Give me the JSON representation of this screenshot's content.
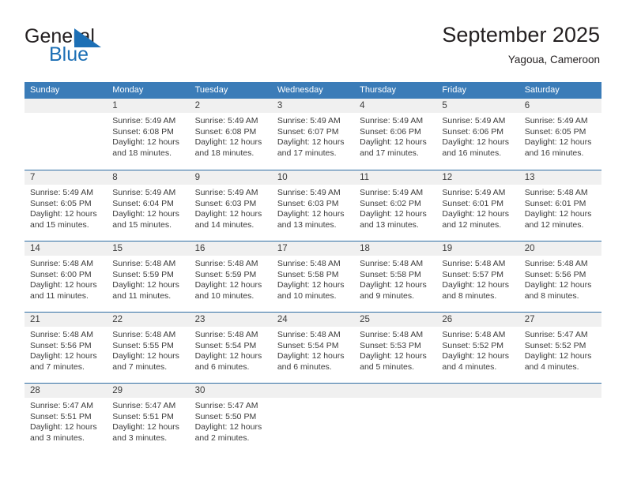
{
  "brand": {
    "name_top": "General",
    "name_bottom": "Blue",
    "flag_color": "#1c6fb5",
    "icon": "triangle-flag-icon"
  },
  "header": {
    "title": "September 2025",
    "subtitle": "Yagoua, Cameroon"
  },
  "theme": {
    "header_row_bg": "#3b7cb8",
    "row_divider": "#2e6da4",
    "day_number_bg": "#f0f0f0",
    "text": "#3b3b3b"
  },
  "weekdays": [
    "Sunday",
    "Monday",
    "Tuesday",
    "Wednesday",
    "Thursday",
    "Friday",
    "Saturday"
  ],
  "weeks": [
    [
      {
        "day": "",
        "lines": []
      },
      {
        "day": "1",
        "lines": [
          "Sunrise: 5:49 AM",
          "Sunset: 6:08 PM",
          "Daylight: 12 hours",
          "and 18 minutes."
        ]
      },
      {
        "day": "2",
        "lines": [
          "Sunrise: 5:49 AM",
          "Sunset: 6:08 PM",
          "Daylight: 12 hours",
          "and 18 minutes."
        ]
      },
      {
        "day": "3",
        "lines": [
          "Sunrise: 5:49 AM",
          "Sunset: 6:07 PM",
          "Daylight: 12 hours",
          "and 17 minutes."
        ]
      },
      {
        "day": "4",
        "lines": [
          "Sunrise: 5:49 AM",
          "Sunset: 6:06 PM",
          "Daylight: 12 hours",
          "and 17 minutes."
        ]
      },
      {
        "day": "5",
        "lines": [
          "Sunrise: 5:49 AM",
          "Sunset: 6:06 PM",
          "Daylight: 12 hours",
          "and 16 minutes."
        ]
      },
      {
        "day": "6",
        "lines": [
          "Sunrise: 5:49 AM",
          "Sunset: 6:05 PM",
          "Daylight: 12 hours",
          "and 16 minutes."
        ]
      }
    ],
    [
      {
        "day": "7",
        "lines": [
          "Sunrise: 5:49 AM",
          "Sunset: 6:05 PM",
          "Daylight: 12 hours",
          "and 15 minutes."
        ]
      },
      {
        "day": "8",
        "lines": [
          "Sunrise: 5:49 AM",
          "Sunset: 6:04 PM",
          "Daylight: 12 hours",
          "and 15 minutes."
        ]
      },
      {
        "day": "9",
        "lines": [
          "Sunrise: 5:49 AM",
          "Sunset: 6:03 PM",
          "Daylight: 12 hours",
          "and 14 minutes."
        ]
      },
      {
        "day": "10",
        "lines": [
          "Sunrise: 5:49 AM",
          "Sunset: 6:03 PM",
          "Daylight: 12 hours",
          "and 13 minutes."
        ]
      },
      {
        "day": "11",
        "lines": [
          "Sunrise: 5:49 AM",
          "Sunset: 6:02 PM",
          "Daylight: 12 hours",
          "and 13 minutes."
        ]
      },
      {
        "day": "12",
        "lines": [
          "Sunrise: 5:49 AM",
          "Sunset: 6:01 PM",
          "Daylight: 12 hours",
          "and 12 minutes."
        ]
      },
      {
        "day": "13",
        "lines": [
          "Sunrise: 5:48 AM",
          "Sunset: 6:01 PM",
          "Daylight: 12 hours",
          "and 12 minutes."
        ]
      }
    ],
    [
      {
        "day": "14",
        "lines": [
          "Sunrise: 5:48 AM",
          "Sunset: 6:00 PM",
          "Daylight: 12 hours",
          "and 11 minutes."
        ]
      },
      {
        "day": "15",
        "lines": [
          "Sunrise: 5:48 AM",
          "Sunset: 5:59 PM",
          "Daylight: 12 hours",
          "and 11 minutes."
        ]
      },
      {
        "day": "16",
        "lines": [
          "Sunrise: 5:48 AM",
          "Sunset: 5:59 PM",
          "Daylight: 12 hours",
          "and 10 minutes."
        ]
      },
      {
        "day": "17",
        "lines": [
          "Sunrise: 5:48 AM",
          "Sunset: 5:58 PM",
          "Daylight: 12 hours",
          "and 10 minutes."
        ]
      },
      {
        "day": "18",
        "lines": [
          "Sunrise: 5:48 AM",
          "Sunset: 5:58 PM",
          "Daylight: 12 hours",
          "and 9 minutes."
        ]
      },
      {
        "day": "19",
        "lines": [
          "Sunrise: 5:48 AM",
          "Sunset: 5:57 PM",
          "Daylight: 12 hours",
          "and 8 minutes."
        ]
      },
      {
        "day": "20",
        "lines": [
          "Sunrise: 5:48 AM",
          "Sunset: 5:56 PM",
          "Daylight: 12 hours",
          "and 8 minutes."
        ]
      }
    ],
    [
      {
        "day": "21",
        "lines": [
          "Sunrise: 5:48 AM",
          "Sunset: 5:56 PM",
          "Daylight: 12 hours",
          "and 7 minutes."
        ]
      },
      {
        "day": "22",
        "lines": [
          "Sunrise: 5:48 AM",
          "Sunset: 5:55 PM",
          "Daylight: 12 hours",
          "and 7 minutes."
        ]
      },
      {
        "day": "23",
        "lines": [
          "Sunrise: 5:48 AM",
          "Sunset: 5:54 PM",
          "Daylight: 12 hours",
          "and 6 minutes."
        ]
      },
      {
        "day": "24",
        "lines": [
          "Sunrise: 5:48 AM",
          "Sunset: 5:54 PM",
          "Daylight: 12 hours",
          "and 6 minutes."
        ]
      },
      {
        "day": "25",
        "lines": [
          "Sunrise: 5:48 AM",
          "Sunset: 5:53 PM",
          "Daylight: 12 hours",
          "and 5 minutes."
        ]
      },
      {
        "day": "26",
        "lines": [
          "Sunrise: 5:48 AM",
          "Sunset: 5:52 PM",
          "Daylight: 12 hours",
          "and 4 minutes."
        ]
      },
      {
        "day": "27",
        "lines": [
          "Sunrise: 5:47 AM",
          "Sunset: 5:52 PM",
          "Daylight: 12 hours",
          "and 4 minutes."
        ]
      }
    ],
    [
      {
        "day": "28",
        "lines": [
          "Sunrise: 5:47 AM",
          "Sunset: 5:51 PM",
          "Daylight: 12 hours",
          "and 3 minutes."
        ]
      },
      {
        "day": "29",
        "lines": [
          "Sunrise: 5:47 AM",
          "Sunset: 5:51 PM",
          "Daylight: 12 hours",
          "and 3 minutes."
        ]
      },
      {
        "day": "30",
        "lines": [
          "Sunrise: 5:47 AM",
          "Sunset: 5:50 PM",
          "Daylight: 12 hours",
          "and 2 minutes."
        ]
      },
      {
        "day": "",
        "lines": []
      },
      {
        "day": "",
        "lines": []
      },
      {
        "day": "",
        "lines": []
      },
      {
        "day": "",
        "lines": []
      }
    ]
  ]
}
